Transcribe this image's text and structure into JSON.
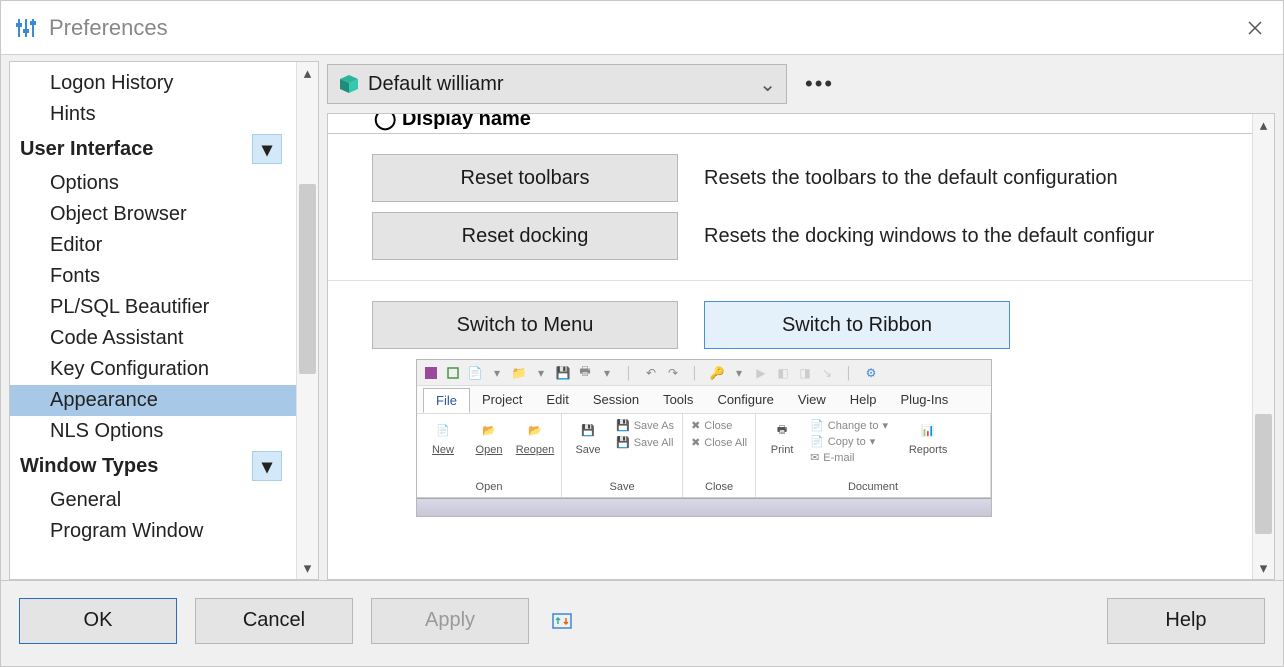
{
  "window": {
    "title": "Preferences"
  },
  "profile": {
    "selected": "Default williamr"
  },
  "sidebar": {
    "items": [
      {
        "label": "Logon History",
        "type": "item"
      },
      {
        "label": "Hints",
        "type": "item"
      },
      {
        "label": "User Interface",
        "type": "category"
      },
      {
        "label": "Options",
        "type": "item"
      },
      {
        "label": "Object Browser",
        "type": "item"
      },
      {
        "label": "Editor",
        "type": "item"
      },
      {
        "label": "Fonts",
        "type": "item"
      },
      {
        "label": "PL/SQL Beautifier",
        "type": "item"
      },
      {
        "label": "Code Assistant",
        "type": "item"
      },
      {
        "label": "Key Configuration",
        "type": "item"
      },
      {
        "label": "Appearance",
        "type": "item",
        "selected": true
      },
      {
        "label": "NLS Options",
        "type": "item"
      },
      {
        "label": "Window Types",
        "type": "category"
      },
      {
        "label": "General",
        "type": "item"
      },
      {
        "label": "Program Window",
        "type": "item"
      }
    ]
  },
  "content": {
    "cropped_header": "Display name",
    "reset_toolbars": {
      "button": "Reset toolbars",
      "desc": "Resets the toolbars to the default configuration"
    },
    "reset_docking": {
      "button": "Reset docking",
      "desc": "Resets the docking windows to the default configur"
    },
    "switch_menu": "Switch to Menu",
    "switch_ribbon": "Switch to Ribbon",
    "preview": {
      "menus": [
        "File",
        "Project",
        "Edit",
        "Session",
        "Tools",
        "Configure",
        "View",
        "Help",
        "Plug-Ins"
      ],
      "groups": {
        "open": {
          "title": "Open",
          "buttons": [
            "New",
            "Open",
            "Reopen"
          ]
        },
        "save": {
          "title": "Save",
          "big": "Save",
          "small": [
            "Save As",
            "Save All"
          ]
        },
        "close": {
          "title": "Close",
          "small": [
            "Close",
            "Close All"
          ]
        },
        "doc": {
          "title": "Document",
          "big": "Print",
          "small": [
            "Change to",
            "Copy to",
            "E-mail"
          ],
          "right": "Reports"
        }
      }
    }
  },
  "footer": {
    "ok": "OK",
    "cancel": "Cancel",
    "apply": "Apply",
    "help": "Help"
  }
}
